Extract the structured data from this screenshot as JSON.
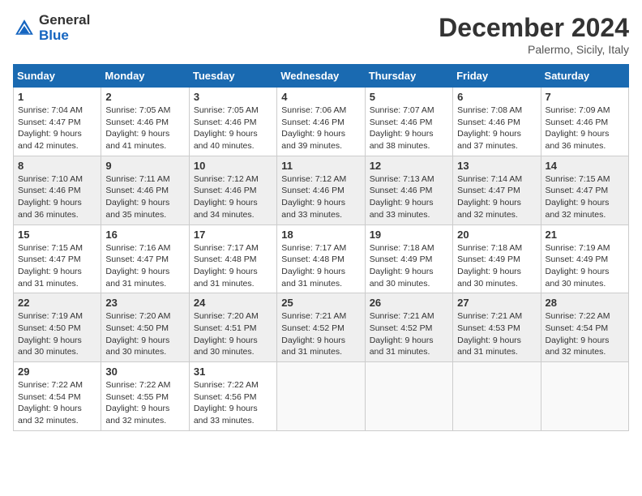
{
  "header": {
    "logo_line1": "General",
    "logo_line2": "Blue",
    "month": "December 2024",
    "location": "Palermo, Sicily, Italy"
  },
  "days_of_week": [
    "Sunday",
    "Monday",
    "Tuesday",
    "Wednesday",
    "Thursday",
    "Friday",
    "Saturday"
  ],
  "weeks": [
    [
      {
        "day": "1",
        "sunrise": "7:04 AM",
        "sunset": "4:47 PM",
        "daylight": "9 hours and 42 minutes."
      },
      {
        "day": "2",
        "sunrise": "7:05 AM",
        "sunset": "4:46 PM",
        "daylight": "9 hours and 41 minutes."
      },
      {
        "day": "3",
        "sunrise": "7:05 AM",
        "sunset": "4:46 PM",
        "daylight": "9 hours and 40 minutes."
      },
      {
        "day": "4",
        "sunrise": "7:06 AM",
        "sunset": "4:46 PM",
        "daylight": "9 hours and 39 minutes."
      },
      {
        "day": "5",
        "sunrise": "7:07 AM",
        "sunset": "4:46 PM",
        "daylight": "9 hours and 38 minutes."
      },
      {
        "day": "6",
        "sunrise": "7:08 AM",
        "sunset": "4:46 PM",
        "daylight": "9 hours and 37 minutes."
      },
      {
        "day": "7",
        "sunrise": "7:09 AM",
        "sunset": "4:46 PM",
        "daylight": "9 hours and 36 minutes."
      }
    ],
    [
      {
        "day": "8",
        "sunrise": "7:10 AM",
        "sunset": "4:46 PM",
        "daylight": "9 hours and 36 minutes."
      },
      {
        "day": "9",
        "sunrise": "7:11 AM",
        "sunset": "4:46 PM",
        "daylight": "9 hours and 35 minutes."
      },
      {
        "day": "10",
        "sunrise": "7:12 AM",
        "sunset": "4:46 PM",
        "daylight": "9 hours and 34 minutes."
      },
      {
        "day": "11",
        "sunrise": "7:12 AM",
        "sunset": "4:46 PM",
        "daylight": "9 hours and 33 minutes."
      },
      {
        "day": "12",
        "sunrise": "7:13 AM",
        "sunset": "4:46 PM",
        "daylight": "9 hours and 33 minutes."
      },
      {
        "day": "13",
        "sunrise": "7:14 AM",
        "sunset": "4:47 PM",
        "daylight": "9 hours and 32 minutes."
      },
      {
        "day": "14",
        "sunrise": "7:15 AM",
        "sunset": "4:47 PM",
        "daylight": "9 hours and 32 minutes."
      }
    ],
    [
      {
        "day": "15",
        "sunrise": "7:15 AM",
        "sunset": "4:47 PM",
        "daylight": "9 hours and 31 minutes."
      },
      {
        "day": "16",
        "sunrise": "7:16 AM",
        "sunset": "4:47 PM",
        "daylight": "9 hours and 31 minutes."
      },
      {
        "day": "17",
        "sunrise": "7:17 AM",
        "sunset": "4:48 PM",
        "daylight": "9 hours and 31 minutes."
      },
      {
        "day": "18",
        "sunrise": "7:17 AM",
        "sunset": "4:48 PM",
        "daylight": "9 hours and 31 minutes."
      },
      {
        "day": "19",
        "sunrise": "7:18 AM",
        "sunset": "4:49 PM",
        "daylight": "9 hours and 30 minutes."
      },
      {
        "day": "20",
        "sunrise": "7:18 AM",
        "sunset": "4:49 PM",
        "daylight": "9 hours and 30 minutes."
      },
      {
        "day": "21",
        "sunrise": "7:19 AM",
        "sunset": "4:49 PM",
        "daylight": "9 hours and 30 minutes."
      }
    ],
    [
      {
        "day": "22",
        "sunrise": "7:19 AM",
        "sunset": "4:50 PM",
        "daylight": "9 hours and 30 minutes."
      },
      {
        "day": "23",
        "sunrise": "7:20 AM",
        "sunset": "4:50 PM",
        "daylight": "9 hours and 30 minutes."
      },
      {
        "day": "24",
        "sunrise": "7:20 AM",
        "sunset": "4:51 PM",
        "daylight": "9 hours and 30 minutes."
      },
      {
        "day": "25",
        "sunrise": "7:21 AM",
        "sunset": "4:52 PM",
        "daylight": "9 hours and 31 minutes."
      },
      {
        "day": "26",
        "sunrise": "7:21 AM",
        "sunset": "4:52 PM",
        "daylight": "9 hours and 31 minutes."
      },
      {
        "day": "27",
        "sunrise": "7:21 AM",
        "sunset": "4:53 PM",
        "daylight": "9 hours and 31 minutes."
      },
      {
        "day": "28",
        "sunrise": "7:22 AM",
        "sunset": "4:54 PM",
        "daylight": "9 hours and 32 minutes."
      }
    ],
    [
      {
        "day": "29",
        "sunrise": "7:22 AM",
        "sunset": "4:54 PM",
        "daylight": "9 hours and 32 minutes."
      },
      {
        "day": "30",
        "sunrise": "7:22 AM",
        "sunset": "4:55 PM",
        "daylight": "9 hours and 32 minutes."
      },
      {
        "day": "31",
        "sunrise": "7:22 AM",
        "sunset": "4:56 PM",
        "daylight": "9 hours and 33 minutes."
      },
      null,
      null,
      null,
      null
    ]
  ]
}
